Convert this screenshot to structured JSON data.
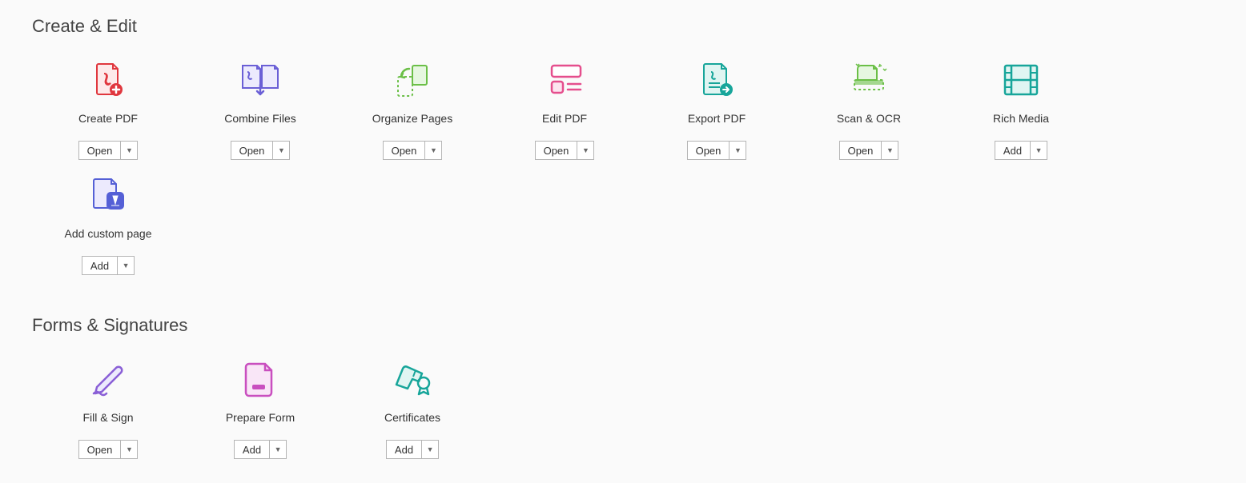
{
  "sections": [
    {
      "title": "Create & Edit",
      "tools": [
        {
          "label": "Create PDF",
          "button": "Open",
          "icon": "create-pdf-icon"
        },
        {
          "label": "Combine Files",
          "button": "Open",
          "icon": "combine-files-icon"
        },
        {
          "label": "Organize Pages",
          "button": "Open",
          "icon": "organize-pages-icon"
        },
        {
          "label": "Edit PDF",
          "button": "Open",
          "icon": "edit-pdf-icon"
        },
        {
          "label": "Export PDF",
          "button": "Open",
          "icon": "export-pdf-icon"
        },
        {
          "label": "Scan & OCR",
          "button": "Open",
          "icon": "scan-ocr-icon"
        },
        {
          "label": "Rich Media",
          "button": "Add",
          "icon": "rich-media-icon"
        },
        {
          "label": "Add custom page",
          "button": "Add",
          "icon": "add-custom-page-icon"
        }
      ]
    },
    {
      "title": "Forms & Signatures",
      "tools": [
        {
          "label": "Fill & Sign",
          "button": "Open",
          "icon": "fill-sign-icon"
        },
        {
          "label": "Prepare Form",
          "button": "Add",
          "icon": "prepare-form-icon"
        },
        {
          "label": "Certificates",
          "button": "Add",
          "icon": "certificates-icon"
        }
      ]
    }
  ]
}
